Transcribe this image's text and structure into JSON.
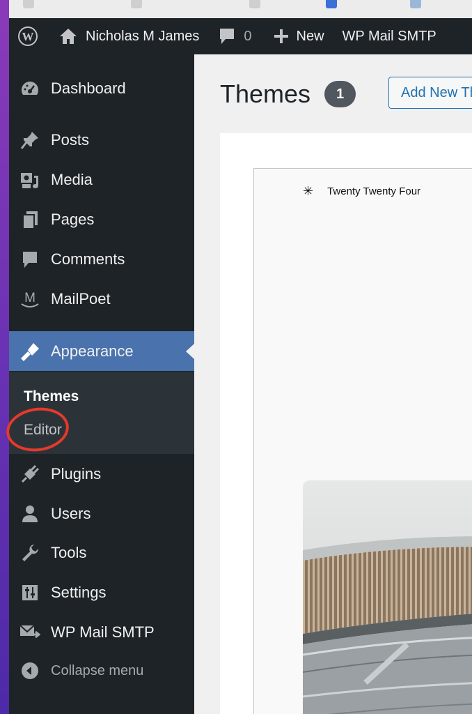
{
  "admin_bar": {
    "site_name": "Nicholas M James",
    "comment_count": "0",
    "new_label": "New",
    "smtp_label": "WP Mail SMTP"
  },
  "sidebar": {
    "items": [
      {
        "label": "Dashboard",
        "icon": "dashboard-icon"
      },
      {
        "label": "Posts",
        "icon": "pin-icon"
      },
      {
        "label": "Media",
        "icon": "media-icon"
      },
      {
        "label": "Pages",
        "icon": "pages-icon"
      },
      {
        "label": "Comments",
        "icon": "comment-icon"
      },
      {
        "label": "MailPoet",
        "icon": "mailpoet-icon"
      },
      {
        "label": "Appearance",
        "icon": "paintbrush-icon"
      },
      {
        "label": "Plugins",
        "icon": "plug-icon"
      },
      {
        "label": "Users",
        "icon": "user-icon"
      },
      {
        "label": "Tools",
        "icon": "wrench-icon"
      },
      {
        "label": "Settings",
        "icon": "settings-icon"
      },
      {
        "label": "WP Mail SMTP",
        "icon": "mail-icon"
      }
    ],
    "submenu": [
      {
        "label": "Themes"
      },
      {
        "label": "Editor"
      }
    ],
    "collapse_label": "Collapse menu"
  },
  "main": {
    "title": "Themes",
    "count": "1",
    "add_new_label": "Add New Theme",
    "theme_name": "Twenty Twenty Four"
  },
  "colors": {
    "admin_bg": "#1d2327",
    "current_menu": "#4a72ac",
    "annotation_circle": "#e43a2b"
  }
}
